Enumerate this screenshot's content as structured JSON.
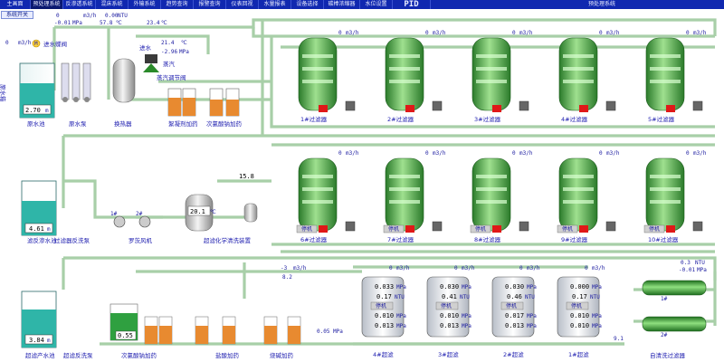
{
  "menu": {
    "items": [
      "主画面",
      "预处理系统",
      "反渗透系统",
      "混床系统",
      "外输系统",
      "趋势查询",
      "报警查询",
      "仪表回视",
      "水量报表",
      "设备选择",
      "碳棒浓缩器",
      "水位设置",
      "PID"
    ],
    "active_title": "预处理系统"
  },
  "system_switch": "系统开关",
  "top": {
    "raw_flow_val": "0",
    "flow_unit": "m3/h",
    "raw_flow2": "0",
    "ntu_val": "0.00",
    "ntu_unit": "NTU",
    "press_a": "-0.01",
    "mpa": "MPa",
    "temp_a": "57.8",
    "deg": "℃",
    "raw_temp": "23.4",
    "temp_b": "21.4",
    "press_b": "-2.96",
    "steam_label": "蒸汽",
    "steam_valve_label": "蒸汽调节阀",
    "steam_inlet": "进水",
    "m_label": "M",
    "inlet_pump_label": "进水蝶阀"
  },
  "tanks": {
    "raw_tank_label": "原水池",
    "raw_tank_level": "2.70",
    "level_unit": "m",
    "raw_tank_side": "原水箱",
    "backwash_tank_label": "滤反渗水池",
    "backwash_level": "4.61",
    "product_tank_label": "超滤产水池",
    "product_level": "3.84"
  },
  "equipment": {
    "raw_pump": "原水泵",
    "heat_exchanger": "换热器",
    "coagulant": "絮凝剂加药",
    "hypochlorite": "次氯酸钠加药",
    "backwash_pump": "过滤器反洗泵",
    "blower": "罗茨风机",
    "chem_clean": "超滤化学清洗装置",
    "chem_temp": "20.1",
    "chem_val": "15.8",
    "uf_backwash_pump": "超滤反洗泵",
    "hypo2": "次氯酸钠加药",
    "hcl": "盐酸加药",
    "naoh": "烧碱加药",
    "uf_dose_level": "0.55",
    "self_clean": "自清洗过滤器",
    "filter1": "1#",
    "filter2": "2#",
    "self_ntu": "0.3",
    "self_press": "-0.01",
    "pump1": "1#",
    "pump2": "2#"
  },
  "filters_row1": [
    {
      "label": "1#过滤器",
      "flow": "0"
    },
    {
      "label": "2#过滤器",
      "flow": "0"
    },
    {
      "label": "3#过滤器",
      "flow": "0"
    },
    {
      "label": "4#过滤器",
      "flow": "0"
    },
    {
      "label": "5#过滤器",
      "flow": "0"
    }
  ],
  "filters_row2": [
    {
      "label": "6#过滤器",
      "flow": "0",
      "status": "停机"
    },
    {
      "label": "7#过滤器",
      "flow": "0",
      "status": "停机"
    },
    {
      "label": "8#过滤器",
      "flow": "0",
      "status": "停机"
    },
    {
      "label": "9#过滤器",
      "flow": "0",
      "status": "停机"
    },
    {
      "label": "10#过滤器",
      "flow": "0",
      "status": "停机"
    }
  ],
  "uf": {
    "flow_m3": "-3",
    "flow_m3_unit": "m3/h",
    "press": "8.2",
    "feed_press": "0.05",
    "feed_press_unit": "MPa",
    "tail": "9.1",
    "units": [
      {
        "label": "4#超滤",
        "flow": "0",
        "v1": "0.033",
        "v2": "0.17",
        "v3": "0.010",
        "status": "停机",
        "v4": "0.013"
      },
      {
        "label": "3#超滤",
        "flow": "0",
        "v1": "0.030",
        "v2": "0.41",
        "v3": "0.010",
        "status": "停机",
        "v4": "0.013"
      },
      {
        "label": "2#超滤",
        "flow": "0",
        "v1": "0.030",
        "v2": "0.46",
        "v3": "0.017",
        "status": "停机",
        "v4": "0.013"
      },
      {
        "label": "1#超滤",
        "flow": "0",
        "v1": "0.000",
        "v2": "0.17",
        "v3": "0.010",
        "status": "停机",
        "v4": "0.010"
      }
    ],
    "u1": "MPa",
    "u2": "NTU"
  },
  "colors": {
    "menu_bg": "#1028b0",
    "pipe": "#a8cfa8",
    "tank_water": "#2fb5a8",
    "vessel": "#3e9e3a",
    "alarm": "#e01818",
    "stop": "#c8c8c8"
  }
}
